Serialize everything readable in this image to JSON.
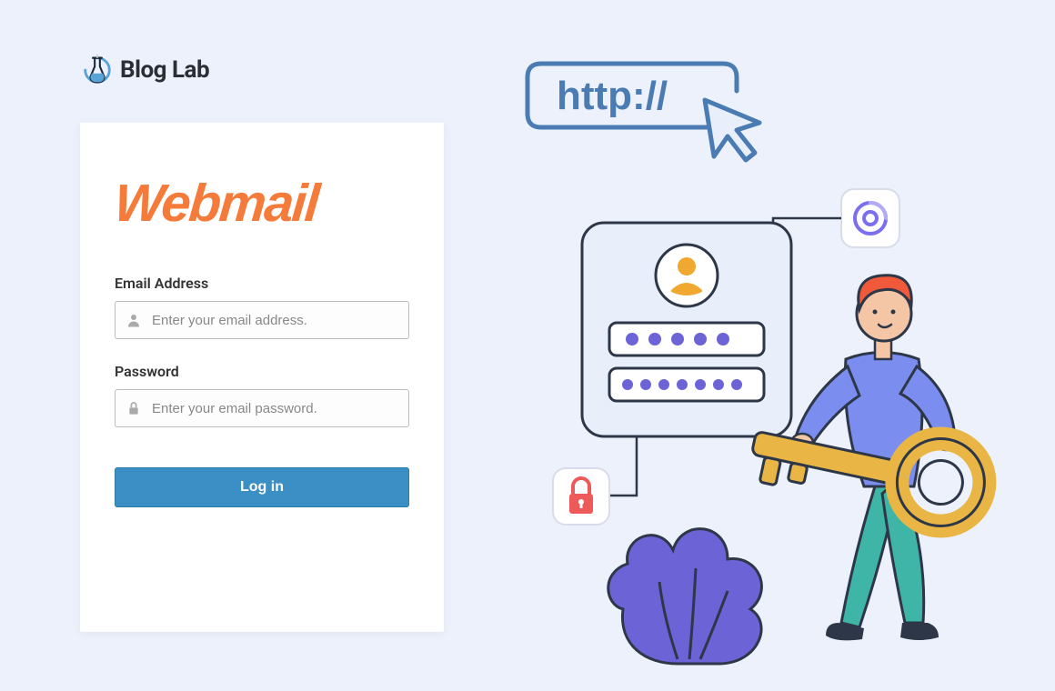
{
  "brand": {
    "name": "Blog Lab"
  },
  "login": {
    "title": "Webmail",
    "email": {
      "label": "Email Address",
      "placeholder": "Enter your email address."
    },
    "password": {
      "label": "Password",
      "placeholder": "Enter your email password."
    },
    "button": "Log in"
  },
  "illustration": {
    "url_text": "http://"
  },
  "colors": {
    "background": "#edf1fb",
    "webmail_orange": "#f47b3a",
    "button_blue": "#3b8fc4",
    "illus_blue": "#4a7bb3",
    "illus_purple": "#6c63d6"
  }
}
